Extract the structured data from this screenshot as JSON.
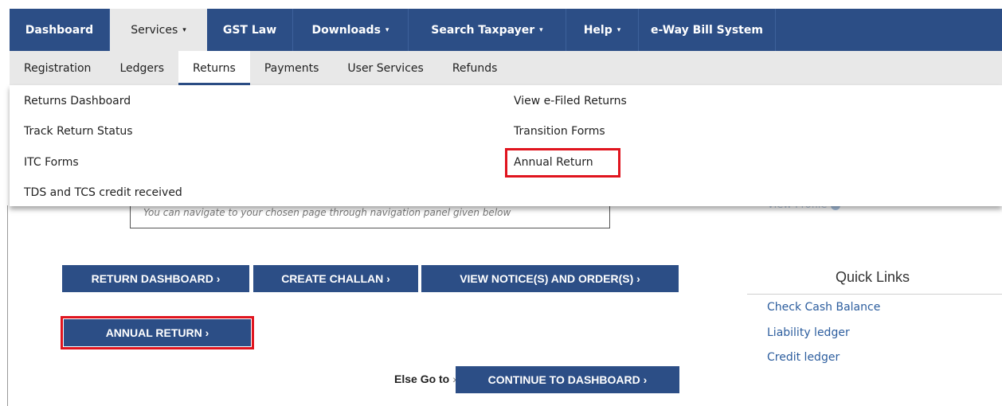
{
  "top_nav": {
    "items": [
      {
        "label": "Dashboard",
        "has_caret": false,
        "active": false
      },
      {
        "label": "Services",
        "has_caret": true,
        "active": true
      },
      {
        "label": "GST Law",
        "has_caret": false,
        "active": false
      },
      {
        "label": "Downloads",
        "has_caret": true,
        "active": false
      },
      {
        "label": "Search Taxpayer",
        "has_caret": true,
        "active": false
      },
      {
        "label": "Help",
        "has_caret": true,
        "active": false
      },
      {
        "label": "e-Way Bill System",
        "has_caret": false,
        "active": false
      }
    ],
    "caret_glyph": "▾"
  },
  "sub_nav": {
    "items": [
      "Registration",
      "Ledgers",
      "Returns",
      "Payments",
      "User Services",
      "Refunds"
    ],
    "active": "Returns"
  },
  "returns_menu": {
    "left": [
      "Returns Dashboard",
      "Track Return Status",
      "ITC Forms",
      "TDS and TCS credit received"
    ],
    "right": [
      "View e-Filed Returns",
      "Transition Forms",
      "Annual Return"
    ],
    "highlighted": "Annual Return"
  },
  "notice": {
    "text": "You can navigate to your chosen page through navigation panel given below"
  },
  "buttons": {
    "return_dashboard": "RETURN DASHBOARD ›",
    "create_challan": "CREATE CHALLAN ›",
    "view_notices": "VIEW NOTICE(S) AND ORDER(S) ›",
    "annual_return": "ANNUAL RETURN ›",
    "continue_dashboard": "CONTINUE TO DASHBOARD ›"
  },
  "else_go_to": {
    "label": "Else Go to",
    "arrow": "»"
  },
  "quick_links": {
    "title": "Quick Links",
    "items": [
      "Check Cash Balance",
      "Liability ledger",
      "Credit ledger"
    ]
  },
  "colors": {
    "nav_bg": "#2c4e86",
    "button_bg": "#2c4e86",
    "highlight_border": "#e0141e",
    "link": "#2c5d9e"
  }
}
